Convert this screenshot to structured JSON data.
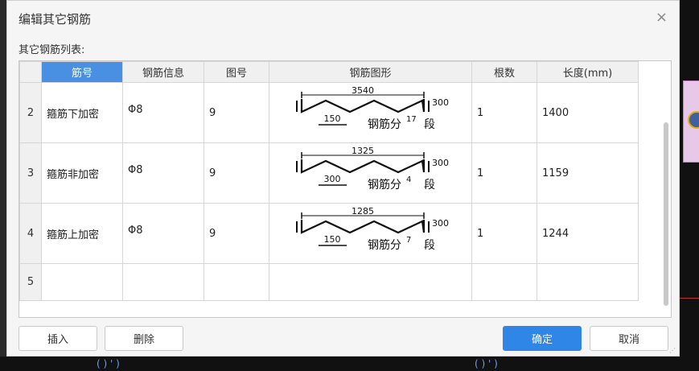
{
  "dialog": {
    "title": "编辑其它钢筋",
    "close_glyph": "×",
    "list_label": "其它钢筋列表:"
  },
  "table": {
    "columns": [
      "",
      "筋号",
      "钢筋信息",
      "图号",
      "钢筋图形",
      "根数",
      "长度(mm)"
    ],
    "selected_column": "筋号",
    "rows": [
      {
        "num": "2",
        "name": "箍筋下加密",
        "info": "Φ8",
        "fig": "9",
        "count": "1",
        "length": "1400",
        "shape": {
          "top": "3540",
          "side": "300",
          "sub": "150",
          "prefix": "钢筋分",
          "seg": "17",
          "suffix": "段"
        }
      },
      {
        "num": "3",
        "name": "箍筋非加密",
        "info": "Φ8",
        "fig": "9",
        "count": "1",
        "length": "1159",
        "shape": {
          "top": "1325",
          "side": "300",
          "sub": "300",
          "prefix": "钢筋分",
          "seg": "4",
          "suffix": "段"
        }
      },
      {
        "num": "4",
        "name": "箍筋上加密",
        "info": "Φ8",
        "fig": "9",
        "count": "1",
        "length": "1244",
        "shape": {
          "top": "1285",
          "side": "300",
          "sub": "150",
          "prefix": "钢筋分",
          "seg": "7",
          "suffix": "段"
        }
      },
      {
        "num": "5",
        "name": "",
        "info": "",
        "fig": "",
        "count": "",
        "length": "",
        "shape": null
      }
    ]
  },
  "buttons": {
    "insert": "插入",
    "delete": "删除",
    "ok": "确定",
    "cancel": "取消"
  },
  "colors": {
    "accent": "#2f86e6",
    "header_selected": "#4a90e2"
  }
}
